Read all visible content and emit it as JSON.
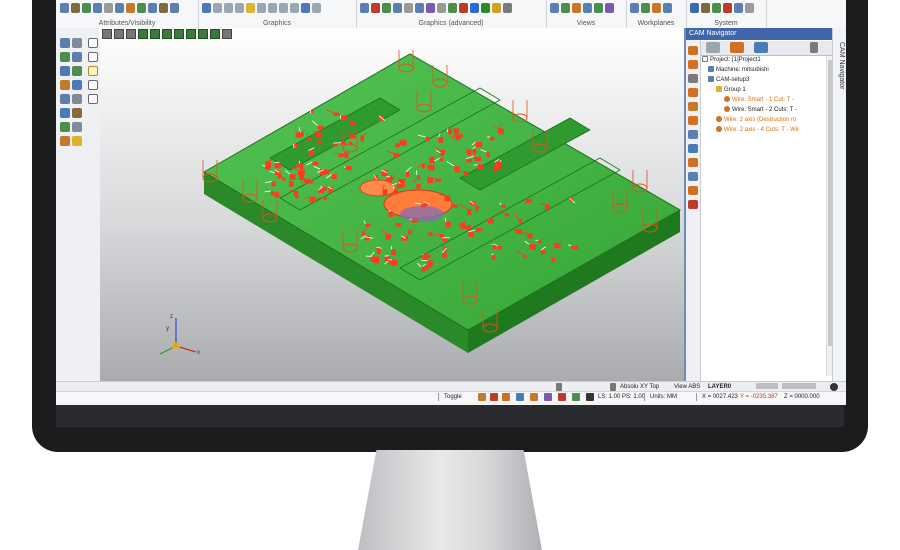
{
  "ribbon": {
    "groups": [
      {
        "label": "Attributes/Visibility",
        "icons": [
          "#5a7fb0",
          "#7e6a3a",
          "#4c8f4c",
          "#5a7fb0",
          "#9a9a9a",
          "#5a7fb0",
          "#c47a2a",
          "#4c8f4c",
          "#5a7fb0",
          "#7e6a3a",
          "#5a7fb0"
        ]
      },
      {
        "label": "Graphics",
        "icons": [
          "#4a7ab8",
          "#9aa6b2",
          "#9aa6b2",
          "#9aa6b2",
          "#e0b030",
          "#9aa6b2",
          "#9aa6b2",
          "#9aa6b2",
          "#9aa6b2",
          "#4a7ab8",
          "#9aa6b2"
        ]
      },
      {
        "label": "Graphics (advanced)",
        "icons": [
          "#5a7fb0",
          "#c03a2a",
          "#4c8f4c",
          "#5a7fb0",
          "#9a9a9a",
          "#5a7fb0",
          "#7a5ab0",
          "#9a9a9a",
          "#4c8f4c",
          "#c03a2a",
          "#2a6ad0",
          "#2a8a2a",
          "#d0a020",
          "#7a7a7a"
        ]
      },
      {
        "label": "Views",
        "icons": [
          "#5a7fb0",
          "#4c8f4c",
          "#c47a2a",
          "#5a7fb0",
          "#4c8f4c",
          "#7a5ab0"
        ]
      },
      {
        "label": "Workplanes",
        "icons": [
          "#5a7fb0",
          "#4c8f4c",
          "#c47a2a",
          "#5a7fb0"
        ]
      },
      {
        "label": "System",
        "icons": [
          "#3a6ab0",
          "#7e6a3a",
          "#4c8f4c",
          "#c03a2a",
          "#5a7fb0",
          "#9a9a9a"
        ]
      }
    ]
  },
  "cam_navigator": {
    "title": "CAM Navigator",
    "vertical_tab": "CAM Navigator",
    "tree": [
      {
        "label": "Project: [1]Project1",
        "icon": "project-icon",
        "color": "#7a7a7a"
      },
      {
        "label": "Machine: mitsubishi",
        "icon": "machine-icon",
        "color": "#5a7fb0"
      },
      {
        "label": "CAM-setup3",
        "icon": "setup-icon",
        "color": "#5a7fb0"
      },
      {
        "label": "Group 1",
        "icon": "folder-icon",
        "color": "#e0b030"
      },
      {
        "label": "Wire: Smart - 1 Cut: T -",
        "icon": "operation-icon",
        "color": "#d07020",
        "selected": true
      },
      {
        "label": "Wire: Smart - 2 Cuts: T -",
        "icon": "operation-icon",
        "color": "#d07020",
        "selected": false
      },
      {
        "label": "Wire: 2 axis (Destruction ro",
        "icon": "operation-icon",
        "color": "#d07020",
        "selected": true
      },
      {
        "label": "Wire: 2 axis - 4 Cuts: T - Wir",
        "icon": "operation-icon",
        "color": "#d07020",
        "selected": true
      }
    ]
  },
  "status": {
    "view_mode": "Absolu XY Top",
    "view_abs": "View ABS",
    "layer": "LAYER0",
    "toggle": "Toggle",
    "ls_ps": "LS: 1.00 PS: 1.00",
    "units": "Units: MM",
    "x": "X = 0027.423",
    "y": "Y = -0235.387",
    "z": "Z = 0000.000"
  },
  "colors": {
    "part_green": "#3fb23f",
    "toolpath_red": "#ff3b1f",
    "accent_blue": "#3e66a8"
  }
}
